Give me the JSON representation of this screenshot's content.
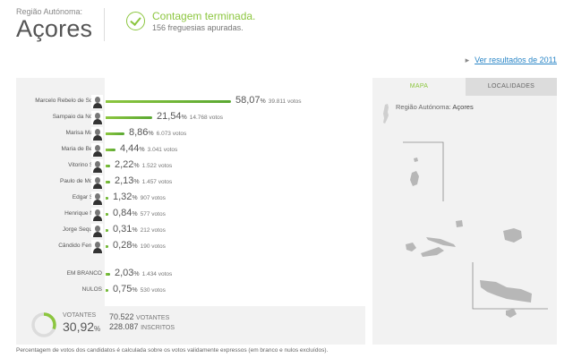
{
  "header": {
    "region_label": "Região Autónoma:",
    "region_name": "Açores",
    "status_title": "Contagem terminada.",
    "status_subtitle": "156 freguesias apuradas."
  },
  "links": {
    "previous_results": "Ver resultados de 2011"
  },
  "candidates": [
    {
      "name": "Marcelo Rebelo de Sousa",
      "pct": "58,07",
      "votes": "39.811 votos",
      "share": 58.07
    },
    {
      "name": "Sampaio da Nóvoa",
      "pct": "21,54",
      "votes": "14.768 votos",
      "share": 21.54
    },
    {
      "name": "Marisa Matias",
      "pct": "8,86",
      "votes": "6.073 votos",
      "share": 8.86
    },
    {
      "name": "Maria de Belém",
      "pct": "4,44",
      "votes": "3.041 votos",
      "share": 4.44
    },
    {
      "name": "Vitorino Silva",
      "pct": "2,22",
      "votes": "1.522 votos",
      "share": 2.22
    },
    {
      "name": "Paulo de Morais",
      "pct": "2,13",
      "votes": "1.457 votos",
      "share": 2.13
    },
    {
      "name": "Edgar Silva",
      "pct": "1,32",
      "votes": "907 votos",
      "share": 1.32
    },
    {
      "name": "Henrique Neto",
      "pct": "0,84",
      "votes": "577 votos",
      "share": 0.84
    },
    {
      "name": "Jorge Sequeira",
      "pct": "0,31",
      "votes": "212 votos",
      "share": 0.31
    },
    {
      "name": "Cândido Ferreira",
      "pct": "0,28",
      "votes": "190 votos",
      "share": 0.28
    }
  ],
  "other": [
    {
      "name": "EM BRANCO",
      "pct": "2,03",
      "votes": "1.434 votos",
      "share": 2.03
    },
    {
      "name": "NULOS",
      "pct": "0,75",
      "votes": "530 votos",
      "share": 0.75
    }
  ],
  "pct_symbol": "%",
  "turnout": {
    "label": "VOTANTES",
    "pct": "30,92",
    "share": 30.92,
    "voters": "70.522",
    "voters_label": "VOTANTES",
    "registered": "228.087",
    "registered_label": "INSCRITOS"
  },
  "footnote": "Percentagem de votos dos candidatos é calculada sobre os votos validamente expressos (em branco e nulos excluídos).",
  "map": {
    "tabs": [
      "MAPA",
      "LOCALIDADES"
    ],
    "active_tab": "MAPA",
    "label_prefix": "Região Autónoma:",
    "label_region": "Açores"
  },
  "colors": {
    "accent": "#8cc63f",
    "link": "#2a86c7",
    "panel": "#f2f2f2"
  }
}
